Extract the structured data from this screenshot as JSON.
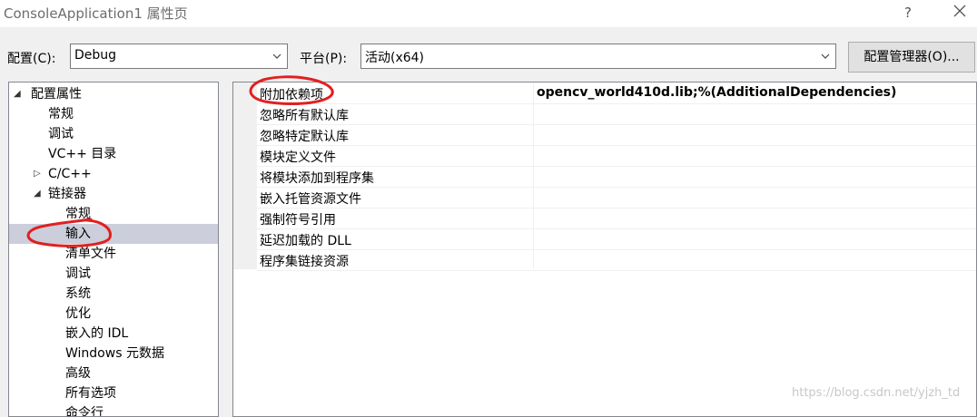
{
  "window": {
    "title": "ConsoleApplication1 属性页",
    "help_label": "?"
  },
  "config": {
    "label": "配置(C):",
    "value": "Debug",
    "platform_label": "平台(P):",
    "platform_value": "活动(x64)",
    "manager_button": "配置管理器(O)..."
  },
  "tree": {
    "root": "配置属性",
    "items": [
      {
        "label": "常规"
      },
      {
        "label": "调试"
      },
      {
        "label": "VC++ 目录"
      },
      {
        "label": "C/C++"
      },
      {
        "label": "链接器"
      },
      {
        "label": "常规"
      },
      {
        "label": "输入"
      },
      {
        "label": "清单文件"
      },
      {
        "label": "调试"
      },
      {
        "label": "系统"
      },
      {
        "label": "优化"
      },
      {
        "label": "嵌入的 IDL"
      },
      {
        "label": "Windows 元数据"
      },
      {
        "label": "高级"
      },
      {
        "label": "所有选项"
      },
      {
        "label": "命令行"
      }
    ]
  },
  "properties": [
    {
      "name": "附加依赖项",
      "value": "opencv_world410d.lib;%(AdditionalDependencies)"
    },
    {
      "name": "忽略所有默认库",
      "value": ""
    },
    {
      "name": "忽略特定默认库",
      "value": ""
    },
    {
      "name": "模块定义文件",
      "value": ""
    },
    {
      "name": "将模块添加到程序集",
      "value": ""
    },
    {
      "name": "嵌入托管资源文件",
      "value": ""
    },
    {
      "name": "强制符号引用",
      "value": ""
    },
    {
      "name": "延迟加载的 DLL",
      "value": ""
    },
    {
      "name": "程序集链接资源",
      "value": ""
    }
  ],
  "watermark": "https://blog.csdn.net/yjzh_td",
  "colors": {
    "selection": "#cccedb",
    "annotation": "#e02020"
  }
}
